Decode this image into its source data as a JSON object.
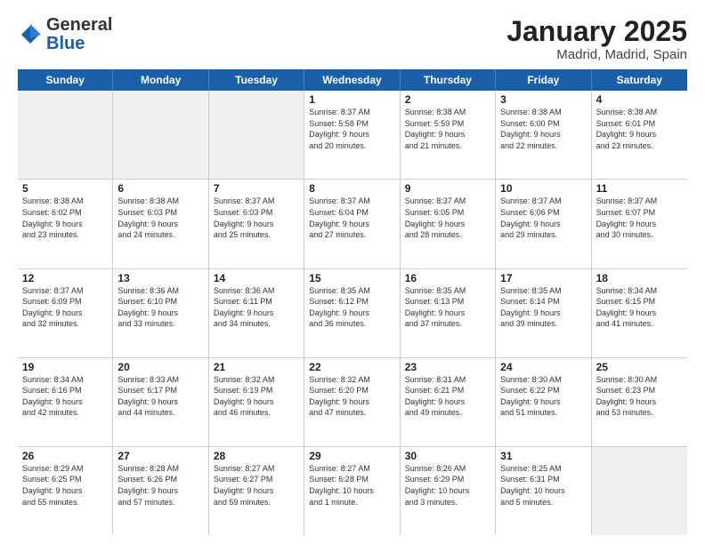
{
  "logo": {
    "general": "General",
    "blue": "Blue"
  },
  "title": "January 2025",
  "subtitle": "Madrid, Madrid, Spain",
  "header_days": [
    "Sunday",
    "Monday",
    "Tuesday",
    "Wednesday",
    "Thursday",
    "Friday",
    "Saturday"
  ],
  "rows": [
    [
      {
        "day": "",
        "info": "",
        "shaded": true
      },
      {
        "day": "",
        "info": "",
        "shaded": true
      },
      {
        "day": "",
        "info": "",
        "shaded": true
      },
      {
        "day": "1",
        "info": "Sunrise: 8:37 AM\nSunset: 5:58 PM\nDaylight: 9 hours\nand 20 minutes."
      },
      {
        "day": "2",
        "info": "Sunrise: 8:38 AM\nSunset: 5:59 PM\nDaylight: 9 hours\nand 21 minutes."
      },
      {
        "day": "3",
        "info": "Sunrise: 8:38 AM\nSunset: 6:00 PM\nDaylight: 9 hours\nand 22 minutes."
      },
      {
        "day": "4",
        "info": "Sunrise: 8:38 AM\nSunset: 6:01 PM\nDaylight: 9 hours\nand 23 minutes."
      }
    ],
    [
      {
        "day": "5",
        "info": "Sunrise: 8:38 AM\nSunset: 6:02 PM\nDaylight: 9 hours\nand 23 minutes."
      },
      {
        "day": "6",
        "info": "Sunrise: 8:38 AM\nSunset: 6:03 PM\nDaylight: 9 hours\nand 24 minutes."
      },
      {
        "day": "7",
        "info": "Sunrise: 8:37 AM\nSunset: 6:03 PM\nDaylight: 9 hours\nand 25 minutes."
      },
      {
        "day": "8",
        "info": "Sunrise: 8:37 AM\nSunset: 6:04 PM\nDaylight: 9 hours\nand 27 minutes."
      },
      {
        "day": "9",
        "info": "Sunrise: 8:37 AM\nSunset: 6:05 PM\nDaylight: 9 hours\nand 28 minutes."
      },
      {
        "day": "10",
        "info": "Sunrise: 8:37 AM\nSunset: 6:06 PM\nDaylight: 9 hours\nand 29 minutes."
      },
      {
        "day": "11",
        "info": "Sunrise: 8:37 AM\nSunset: 6:07 PM\nDaylight: 9 hours\nand 30 minutes."
      }
    ],
    [
      {
        "day": "12",
        "info": "Sunrise: 8:37 AM\nSunset: 6:09 PM\nDaylight: 9 hours\nand 32 minutes."
      },
      {
        "day": "13",
        "info": "Sunrise: 8:36 AM\nSunset: 6:10 PM\nDaylight: 9 hours\nand 33 minutes."
      },
      {
        "day": "14",
        "info": "Sunrise: 8:36 AM\nSunset: 6:11 PM\nDaylight: 9 hours\nand 34 minutes."
      },
      {
        "day": "15",
        "info": "Sunrise: 8:35 AM\nSunset: 6:12 PM\nDaylight: 9 hours\nand 36 minutes."
      },
      {
        "day": "16",
        "info": "Sunrise: 8:35 AM\nSunset: 6:13 PM\nDaylight: 9 hours\nand 37 minutes."
      },
      {
        "day": "17",
        "info": "Sunrise: 8:35 AM\nSunset: 6:14 PM\nDaylight: 9 hours\nand 39 minutes."
      },
      {
        "day": "18",
        "info": "Sunrise: 8:34 AM\nSunset: 6:15 PM\nDaylight: 9 hours\nand 41 minutes."
      }
    ],
    [
      {
        "day": "19",
        "info": "Sunrise: 8:34 AM\nSunset: 6:16 PM\nDaylight: 9 hours\nand 42 minutes."
      },
      {
        "day": "20",
        "info": "Sunrise: 8:33 AM\nSunset: 6:17 PM\nDaylight: 9 hours\nand 44 minutes."
      },
      {
        "day": "21",
        "info": "Sunrise: 8:32 AM\nSunset: 6:19 PM\nDaylight: 9 hours\nand 46 minutes."
      },
      {
        "day": "22",
        "info": "Sunrise: 8:32 AM\nSunset: 6:20 PM\nDaylight: 9 hours\nand 47 minutes."
      },
      {
        "day": "23",
        "info": "Sunrise: 8:31 AM\nSunset: 6:21 PM\nDaylight: 9 hours\nand 49 minutes."
      },
      {
        "day": "24",
        "info": "Sunrise: 8:30 AM\nSunset: 6:22 PM\nDaylight: 9 hours\nand 51 minutes."
      },
      {
        "day": "25",
        "info": "Sunrise: 8:30 AM\nSunset: 6:23 PM\nDaylight: 9 hours\nand 53 minutes."
      }
    ],
    [
      {
        "day": "26",
        "info": "Sunrise: 8:29 AM\nSunset: 6:25 PM\nDaylight: 9 hours\nand 55 minutes."
      },
      {
        "day": "27",
        "info": "Sunrise: 8:28 AM\nSunset: 6:26 PM\nDaylight: 9 hours\nand 57 minutes."
      },
      {
        "day": "28",
        "info": "Sunrise: 8:27 AM\nSunset: 6:27 PM\nDaylight: 9 hours\nand 59 minutes."
      },
      {
        "day": "29",
        "info": "Sunrise: 8:27 AM\nSunset: 6:28 PM\nDaylight: 10 hours\nand 1 minute."
      },
      {
        "day": "30",
        "info": "Sunrise: 8:26 AM\nSunset: 6:29 PM\nDaylight: 10 hours\nand 3 minutes."
      },
      {
        "day": "31",
        "info": "Sunrise: 8:25 AM\nSunset: 6:31 PM\nDaylight: 10 hours\nand 5 minutes."
      },
      {
        "day": "",
        "info": "",
        "shaded": true
      }
    ]
  ]
}
